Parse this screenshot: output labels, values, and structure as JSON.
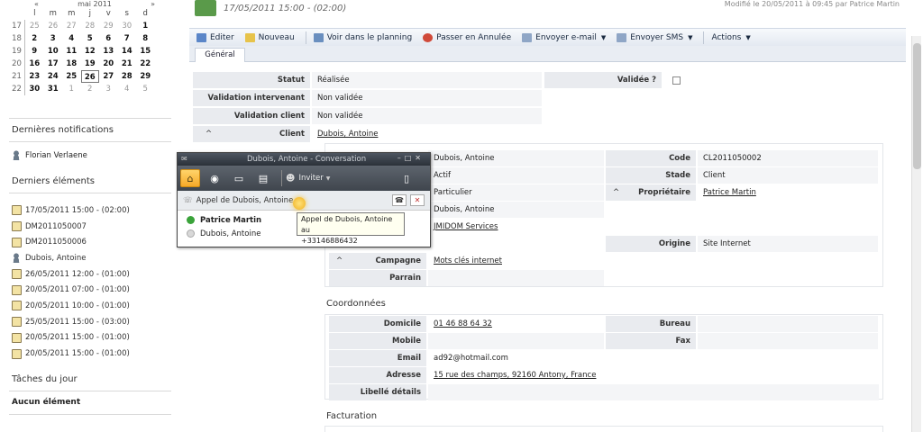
{
  "calendar": {
    "month_label": "mai 2011",
    "prev_label": "«",
    "next_label": "»",
    "days_of_week": [
      "l",
      "m",
      "m",
      "j",
      "v",
      "s",
      "d"
    ],
    "weeks": [
      {
        "num": "17",
        "days": [
          "25",
          "26",
          "27",
          "28",
          "29",
          "30",
          "1"
        ]
      },
      {
        "num": "18",
        "days": [
          "2",
          "3",
          "4",
          "5",
          "6",
          "7",
          "8"
        ]
      },
      {
        "num": "19",
        "days": [
          "9",
          "10",
          "11",
          "12",
          "13",
          "14",
          "15"
        ]
      },
      {
        "num": "20",
        "days": [
          "16",
          "17",
          "18",
          "19",
          "20",
          "21",
          "22"
        ]
      },
      {
        "num": "21",
        "days": [
          "23",
          "24",
          "25",
          "26",
          "27",
          "28",
          "29"
        ]
      },
      {
        "num": "22",
        "days": [
          "30",
          "31",
          "1",
          "2",
          "3",
          "4",
          "5"
        ]
      }
    ]
  },
  "notifications": {
    "title": "Dernières notifications",
    "items": [
      "Florian Verlaene"
    ]
  },
  "recent": {
    "title": "Derniers éléments",
    "items": [
      "17/05/2011 15:00 - (02:00)",
      "DM2011050007",
      "DM2011050006",
      "Dubois, Antoine",
      "26/05/2011 12:00 - (01:00)",
      "20/05/2011 07:00 - (01:00)",
      "20/05/2011 10:00 - (01:00)",
      "25/05/2011 15:00 - (03:00)",
      "20/05/2011 15:00 - (01:00)",
      "20/05/2011 15:00 - (01:00)"
    ]
  },
  "tasks": {
    "title": "Tâches du jour",
    "empty": "Aucun élément"
  },
  "header": {
    "title": "17/05/2011 15:00 - (02:00)",
    "right_text": "Modifié le 20/05/2011 à 09:45 par Patrice Martin"
  },
  "toolbar": {
    "edit": "Editer",
    "new": "Nouveau",
    "planning": "Voir dans le planning",
    "cancel": "Passer en Annulée",
    "email": "Envoyer e-mail",
    "sms": "Envoyer SMS",
    "actions": "Actions"
  },
  "tab": "Général",
  "form": {
    "statut_label": "Statut",
    "statut_value": "Réalisée",
    "validee_label": "Validée ?",
    "validation_intervenant_label": "Validation intervenant",
    "validation_intervenant_value": "Non validée",
    "validation_client_label": "Validation client",
    "validation_client_value": "Non validée",
    "client_label": "Client",
    "client_value": "Dubois, Antoine",
    "nom_value": "Dubois, Antoine",
    "code_label": "Code",
    "code_value": "CL2011050002",
    "etat_value": "Actif",
    "stade_label": "Stade",
    "stade_value": "Client",
    "type_value": "Particulier",
    "proprietaire_label": "Propriétaire",
    "proprietaire_value": "Patrice Martin",
    "contact_value": "Dubois, Antoine",
    "agence_value": "JMIDOM Services",
    "origine_label": "Origine",
    "origine_value": "Site Internet",
    "campagne_label": "Campagne",
    "campagne_value": "Mots clés internet",
    "parrain_label": "Parrain",
    "coordonnees_title": "Coordonnées",
    "domicile_label": "Domicile",
    "domicile_value": "01 46 88 64 32",
    "bureau_label": "Bureau",
    "mobile_label": "Mobile",
    "fax_label": "Fax",
    "email_label": "Email",
    "email_value": "ad92@hotmail.com",
    "adresse_label": "Adresse",
    "adresse_value": "15 rue des champs, 92160 Antony, France",
    "libelle_label": "Libellé détails",
    "facturation_title": "Facturation"
  },
  "conversation": {
    "title": "Dubois, Antoine - Conversation",
    "invite_label": "Inviter",
    "call_text": "Appel de Dubois, Antoine...",
    "participants": [
      "Patrice Martin",
      "Dubois, Antoine"
    ],
    "tooltip_line1": "Appel de Dubois, Antoine au",
    "tooltip_line2": "+33146886432"
  },
  "colors": {
    "toolbar_bg": "#e4e9f1",
    "label_bg": "#e9ebef",
    "conv_title_bg": "#2b3139",
    "presence_online": "#3aa33a",
    "presence_offline": "#d8d8d8",
    "highlight": "#f6a929"
  }
}
